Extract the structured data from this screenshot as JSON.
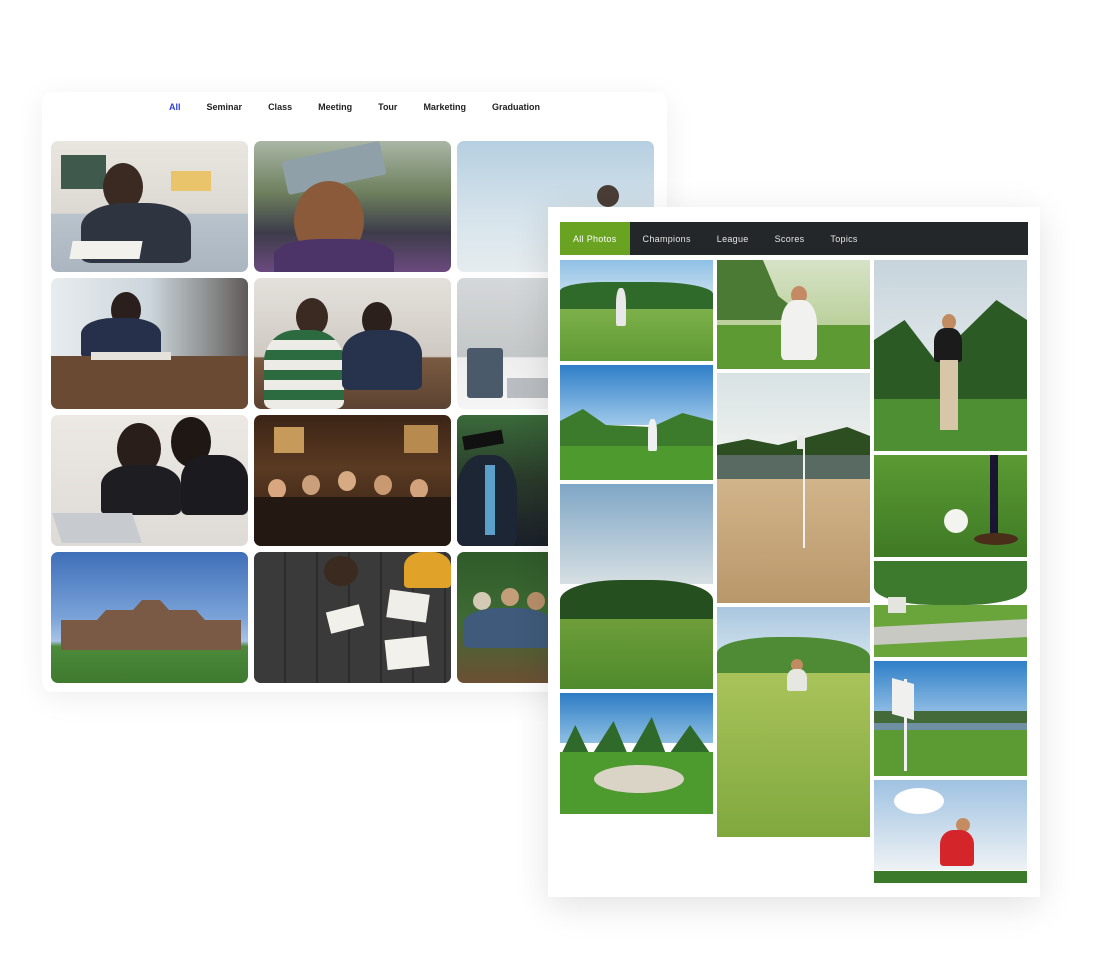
{
  "education_gallery": {
    "filters": [
      {
        "label": "All",
        "active": true
      },
      {
        "label": "Seminar",
        "active": false
      },
      {
        "label": "Class",
        "active": false
      },
      {
        "label": "Meeting",
        "active": false
      },
      {
        "label": "Tour",
        "active": false
      },
      {
        "label": "Marketing",
        "active": false
      },
      {
        "label": "Graduation",
        "active": false
      }
    ],
    "accent_color": "#2e3fd6"
  },
  "golf_gallery": {
    "tabs": [
      {
        "label": "All Photos",
        "active": true
      },
      {
        "label": "Champions",
        "active": false
      },
      {
        "label": "League",
        "active": false
      },
      {
        "label": "Scores",
        "active": false
      },
      {
        "label": "Topics",
        "active": false
      }
    ],
    "accent_color": "#6aa322",
    "nav_color": "#23272a"
  }
}
